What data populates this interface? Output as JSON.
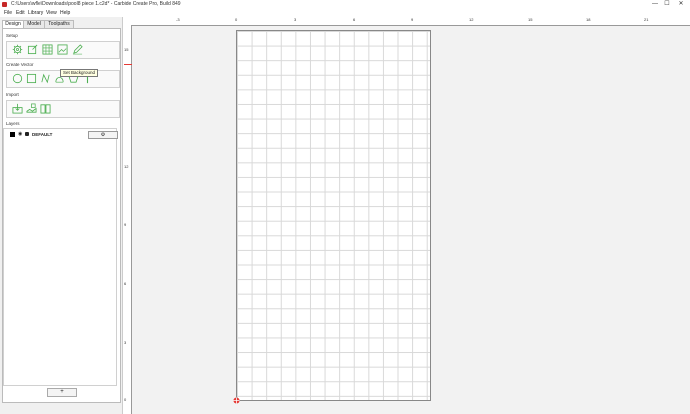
{
  "window": {
    "title": "C:\\Users\\wfle\\Downloads\\pool8 piece 1.c2d* - Carbide Create Pro, Build 849",
    "controls": [
      "—",
      "☐",
      "✕"
    ]
  },
  "menu": [
    "File",
    "Edit",
    "Library",
    "View",
    "Help"
  ],
  "tabs": [
    "Design",
    "Model",
    "Toolpaths"
  ],
  "sections": {
    "setup": "Setup",
    "create_vector": "Create Vector",
    "import": "Import",
    "layers": "Layers"
  },
  "tooltip": "Set Background",
  "layer": {
    "name": "DEFAULT",
    "menu_icon": "⚙"
  },
  "add_layer_label": "+",
  "ruler_h_labels": [
    "-3",
    "0",
    "3",
    "6",
    "9",
    "12",
    "15",
    "18",
    "21"
  ],
  "ruler_v_labels": [
    "15",
    "12",
    "9",
    "6",
    "3",
    "0"
  ],
  "colors": {
    "accent_green": "#4caf50",
    "origin_red": "#e53935"
  }
}
